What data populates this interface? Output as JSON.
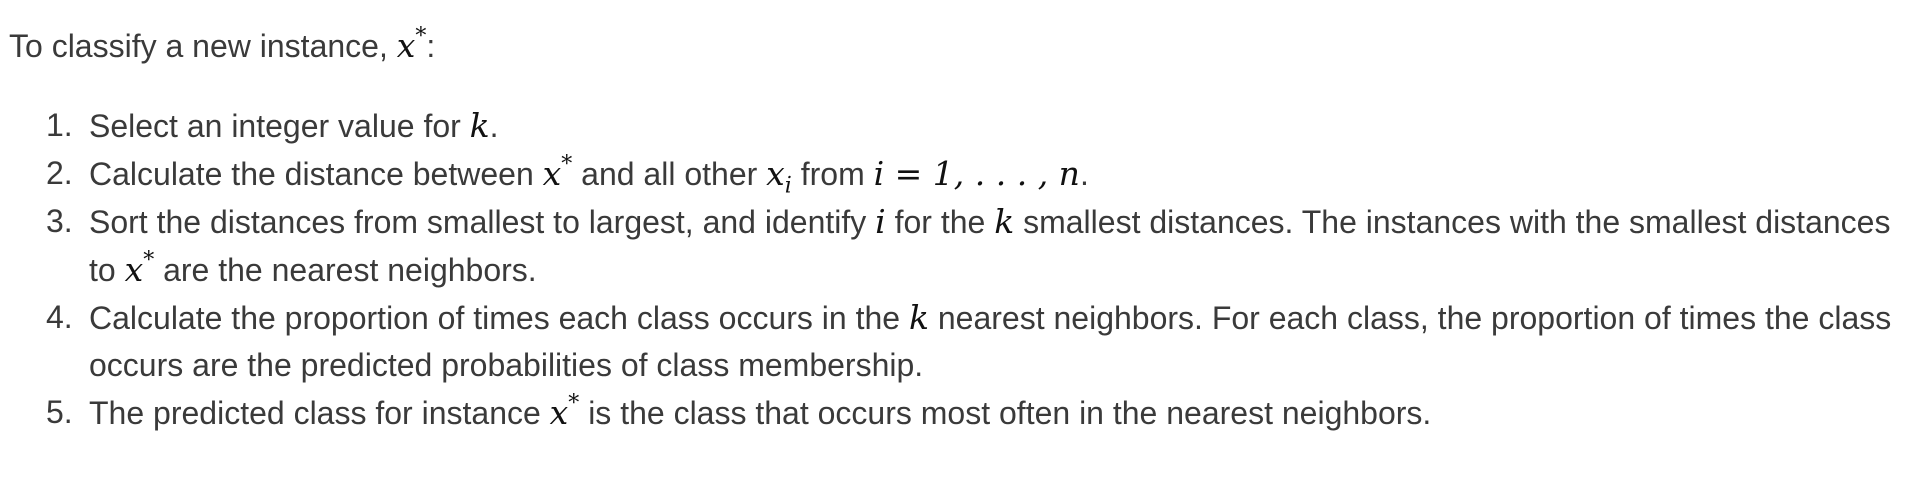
{
  "intro": {
    "text": "To classify a new instance,",
    "var": "x",
    "sup": "*",
    "tail": ":"
  },
  "steps": [
    {
      "number": "1.",
      "text_a": "Select an integer value for",
      "math_k": "k",
      "text_b": "."
    },
    {
      "number": "2.",
      "text_a": "Calculate the distance between",
      "math_x": "x",
      "math_sup": "*",
      "text_b": "and all other",
      "math_xi": "x",
      "math_sub": "i",
      "text_c": "from",
      "math_range": "i = 1, . . . , n",
      "text_d": "."
    },
    {
      "number": "3.",
      "text_a": "Sort the distances from smallest to largest, and identify",
      "math_i": "i",
      "text_b": "for the",
      "math_k": "k",
      "text_c": "smallest distances. The instances with the smallest distances to",
      "math_x": "x",
      "math_sup": "*",
      "text_d": "are the nearest neighbors."
    },
    {
      "number": "4.",
      "text_a": "Calculate the proportion of times each class occurs in the",
      "math_k": "k",
      "text_b": "nearest neighbors. For each class, the proportion of times the class occurs are the predicted probabilities of class membership."
    },
    {
      "number": "5.",
      "text_a": "The predicted class for instance",
      "math_x": "x",
      "math_sup": "*",
      "text_b": "is the class that occurs most often in the nearest neighbors."
    }
  ]
}
